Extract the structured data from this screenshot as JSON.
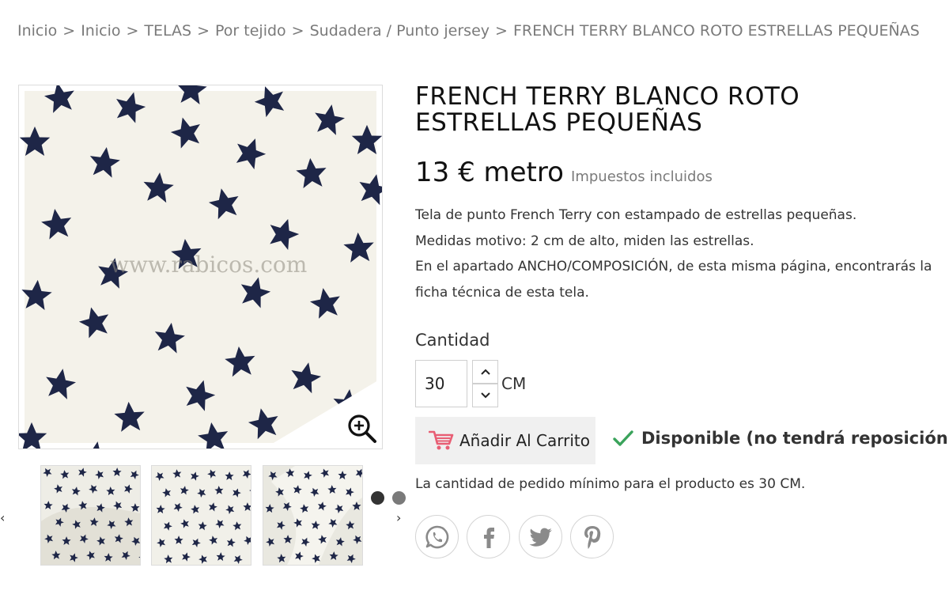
{
  "breadcrumb": [
    "Inicio",
    "Inicio",
    "TELAS",
    "Por tejido",
    "Sudadera / Punto jersey",
    "FRENCH TERRY BLANCO ROTO ESTRELLAS PEQUEÑAS"
  ],
  "breadcrumb_separator": ">",
  "product": {
    "title": "FRENCH TERRY BLANCO ROTO ESTRELLAS PEQUEÑAS",
    "price": "13 € metro",
    "tax_note": "Impuestos incluidos",
    "description": [
      "Tela de punto French Terry con estampado de estrellas pequeñas.",
      "Medidas motivo: 2 cm de alto, miden las estrellas.",
      "En el apartado ANCHO/COMPOSICIÓN, de esta misma página, encontrarás la ficha técnica de esta tela."
    ],
    "image_watermark": "www.rabicos.com"
  },
  "quantity": {
    "label": "Cantidad",
    "value": "30",
    "unit": "CM"
  },
  "cart": {
    "add_label": "Añadir Al Carrito"
  },
  "availability": {
    "text": "Disponible (no tendrá reposición)"
  },
  "min_quantity_note": "La cantidad de pedido mínimo para el producto es 30 CM.",
  "carousel": {
    "prev": "‹",
    "next": "›"
  },
  "share_icons": [
    "whatsapp-icon",
    "facebook-icon",
    "twitter-icon",
    "pinterest-icon"
  ],
  "colors": {
    "star_navy": "#1e2647",
    "fabric": "#f4f2ea",
    "cart_icon": "#e85e74",
    "check_green": "#3aa35b"
  }
}
